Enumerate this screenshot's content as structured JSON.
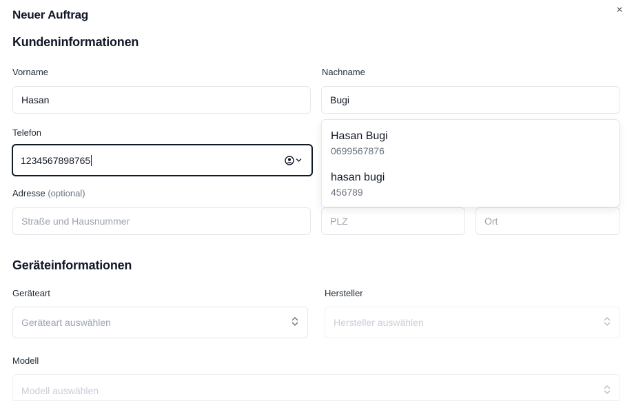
{
  "dialog": {
    "title": "Neuer Auftrag",
    "close_label": "×"
  },
  "customer": {
    "section_title": "Kundeninformationen",
    "first_name": {
      "label": "Vorname",
      "value": "Hasan"
    },
    "last_name": {
      "label": "Nachname",
      "value": "Bugi"
    },
    "phone": {
      "label": "Telefon",
      "value": "1234567898765"
    },
    "address": {
      "label": "Adresse",
      "optional_label": "(optional)",
      "street_placeholder": "Straße und Hausnummer",
      "zip_placeholder": "PLZ",
      "city_placeholder": "Ort"
    },
    "suggestions": [
      {
        "name": "Hasan Bugi",
        "phone": "0699567876"
      },
      {
        "name": "hasan bugi",
        "phone": "456789"
      }
    ]
  },
  "device": {
    "section_title": "Geräteinformationen",
    "type": {
      "label": "Geräteart",
      "placeholder": "Geräteart auswählen"
    },
    "manufacturer": {
      "label": "Hersteller",
      "placeholder": "Hersteller auswählen"
    },
    "model": {
      "label": "Modell",
      "placeholder": "Modell auswählen"
    }
  }
}
